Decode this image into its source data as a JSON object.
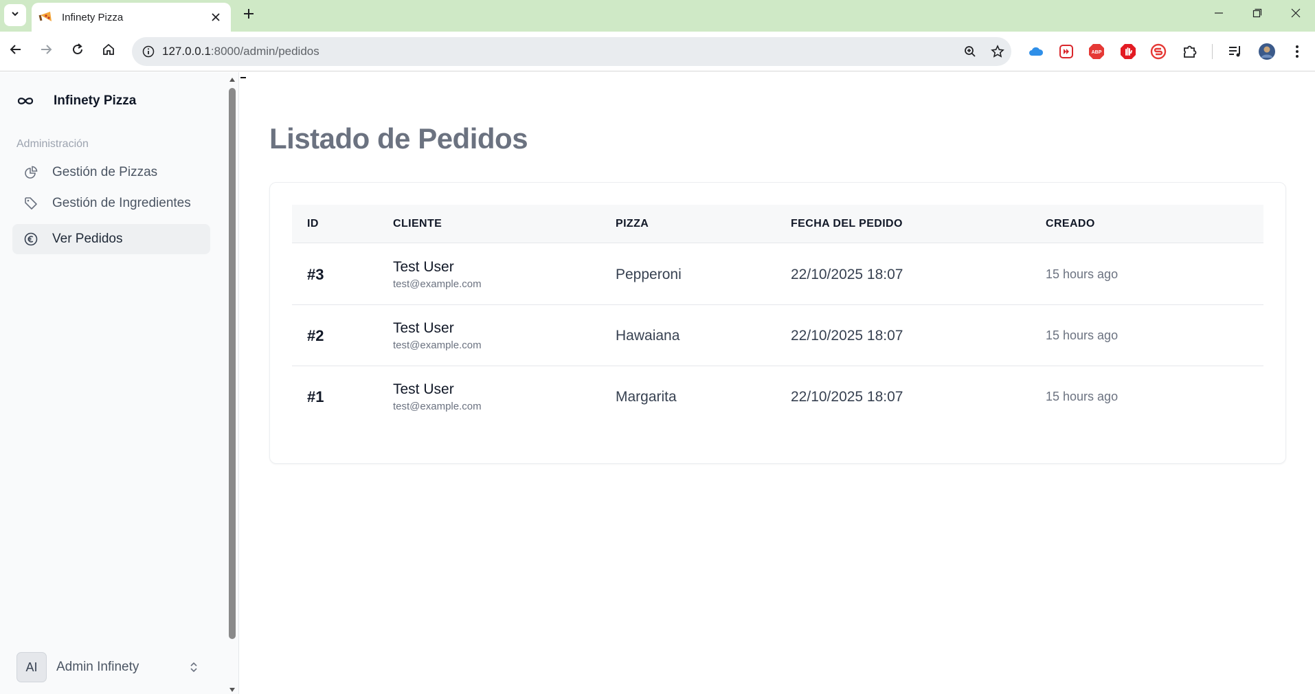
{
  "browser": {
    "tab_title": "Infinety Pizza",
    "url_host": "127.0.0.1",
    "url_path": ":8000/admin/pedidos"
  },
  "app": {
    "brand": "Infinety Pizza",
    "section_label": "Administración",
    "nav": [
      {
        "label": "Gestión de Pizzas",
        "icon": "pie-chart-icon",
        "active": false
      },
      {
        "label": "Gestión de Ingredientes",
        "icon": "tag-icon",
        "active": false
      },
      {
        "label": "Ver Pedidos",
        "icon": "euro-icon",
        "active": true
      }
    ],
    "user": {
      "initials": "AI",
      "name": "Admin Infinety"
    }
  },
  "main": {
    "title": "Listado de Pedidos",
    "columns": [
      "ID",
      "CLIENTE",
      "PIZZA",
      "FECHA DEL PEDIDO",
      "CREADO"
    ],
    "rows": [
      {
        "id": "#3",
        "client_name": "Test User",
        "client_email": "test@example.com",
        "pizza": "Pepperoni",
        "date": "22/10/2025 18:07",
        "created": "15 hours ago"
      },
      {
        "id": "#2",
        "client_name": "Test User",
        "client_email": "test@example.com",
        "pizza": "Hawaiana",
        "date": "22/10/2025 18:07",
        "created": "15 hours ago"
      },
      {
        "id": "#1",
        "client_name": "Test User",
        "client_email": "test@example.com",
        "pizza": "Margarita",
        "date": "22/10/2025 18:07",
        "created": "15 hours ago"
      }
    ]
  },
  "colors": {
    "tabbar": "#cfe9c6",
    "sidebar_bg": "#f9fafb",
    "title_gray": "#6b7280"
  }
}
